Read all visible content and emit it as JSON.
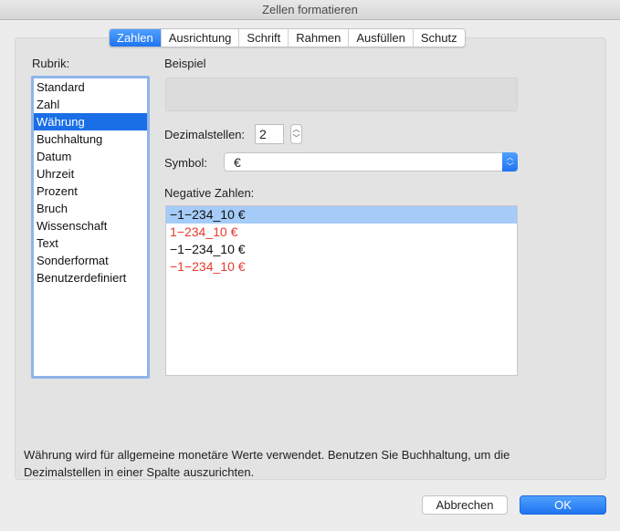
{
  "window": {
    "title": "Zellen formatieren"
  },
  "tabs": [
    {
      "label": "Zahlen",
      "active": true
    },
    {
      "label": "Ausrichtung"
    },
    {
      "label": "Schrift"
    },
    {
      "label": "Rahmen"
    },
    {
      "label": "Ausfüllen"
    },
    {
      "label": "Schutz"
    }
  ],
  "rubrik": {
    "label": "Rubrik:",
    "items": [
      "Standard",
      "Zahl",
      "Währung",
      "Buchhaltung",
      "Datum",
      "Uhrzeit",
      "Prozent",
      "Bruch",
      "Wissenschaft",
      "Text",
      "Sonderformat",
      "Benutzerdefiniert"
    ],
    "selected": "Währung"
  },
  "beispiel": {
    "label": "Beispiel",
    "value": ""
  },
  "dezimal": {
    "label": "Dezimalstellen:",
    "value": "2"
  },
  "symbol": {
    "label": "Symbol:",
    "value": "€"
  },
  "negative": {
    "label": "Negative Zahlen:",
    "items": [
      "−1−234_10 €",
      "1−234_10 €",
      "−1−234_10 €",
      "−1−234_10 €"
    ]
  },
  "description": "Währung wird für allgemeine monetäre Werte verwendet. Benutzen Sie Buchhaltung, um die Dezimalstellen in einer Spalte auszurichten.",
  "buttons": {
    "cancel": "Abbrechen",
    "ok": "OK"
  },
  "colors": {
    "accent": "#1a6ee6",
    "negative_red": "#e8392f"
  }
}
